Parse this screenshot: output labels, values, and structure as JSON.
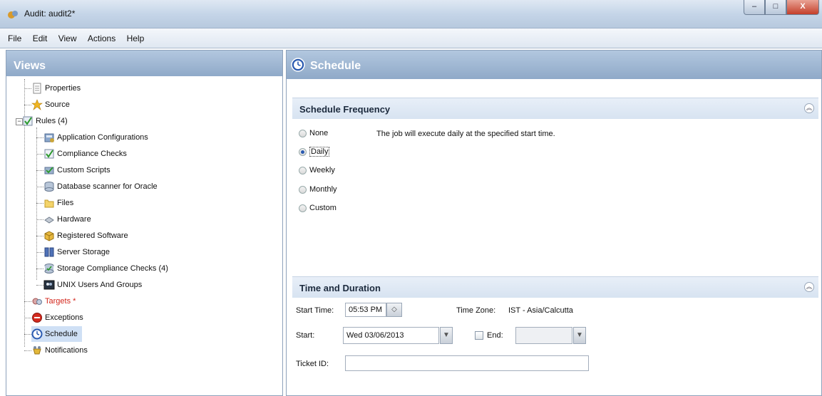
{
  "window": {
    "title": "Audit: audit2*",
    "controls": {
      "minimize": "–",
      "maximize": "□",
      "close": "X"
    }
  },
  "menu": [
    "File",
    "Edit",
    "View",
    "Actions",
    "Help"
  ],
  "views": {
    "header": "Views",
    "items": [
      {
        "label": "Properties",
        "icon": "document-icon"
      },
      {
        "label": "Source",
        "icon": "source-star-icon"
      },
      {
        "label": "Rules (4)",
        "icon": "rules-check-icon"
      },
      {
        "label": "Application Configurations",
        "icon": "app-config-icon"
      },
      {
        "label": "Compliance Checks",
        "icon": "compliance-check-icon"
      },
      {
        "label": "Custom Scripts",
        "icon": "script-icon"
      },
      {
        "label": "Database scanner for Oracle",
        "icon": "database-icon"
      },
      {
        "label": "Files",
        "icon": "folder-icon"
      },
      {
        "label": "Hardware",
        "icon": "hardware-icon"
      },
      {
        "label": "Registered Software",
        "icon": "software-box-icon"
      },
      {
        "label": "Server Storage",
        "icon": "server-storage-icon"
      },
      {
        "label": "Storage Compliance Checks (4)",
        "icon": "storage-check-icon"
      },
      {
        "label": "UNIX Users And Groups",
        "icon": "unix-users-icon"
      },
      {
        "label": "Targets *",
        "icon": "targets-icon"
      },
      {
        "label": "Exceptions",
        "icon": "exceptions-icon"
      },
      {
        "label": "Schedule",
        "icon": "schedule-clock-icon"
      },
      {
        "label": "Notifications",
        "icon": "notifications-icon"
      }
    ]
  },
  "schedule": {
    "header": "Schedule",
    "frequency": {
      "title": "Schedule Frequency",
      "options": [
        "None",
        "Daily",
        "Weekly",
        "Monthly",
        "Custom"
      ],
      "selected": "Daily",
      "description": "The job will execute daily at the specified start time."
    },
    "time": {
      "title": "Time and Duration",
      "start_time_label": "Start Time:",
      "start_time_value": "05:53 PM",
      "timezone_label": "Time Zone:",
      "timezone_value": "IST - Asia/Calcutta",
      "start_label": "Start:",
      "start_value": "Wed 03/06/2013",
      "end_label": "End:",
      "end_value": "",
      "ticket_label": "Ticket ID:",
      "ticket_value": ""
    }
  },
  "colors": {
    "accent": "#8fa9c8",
    "selection": "#cfe0f5",
    "warning": "#d3261c"
  }
}
